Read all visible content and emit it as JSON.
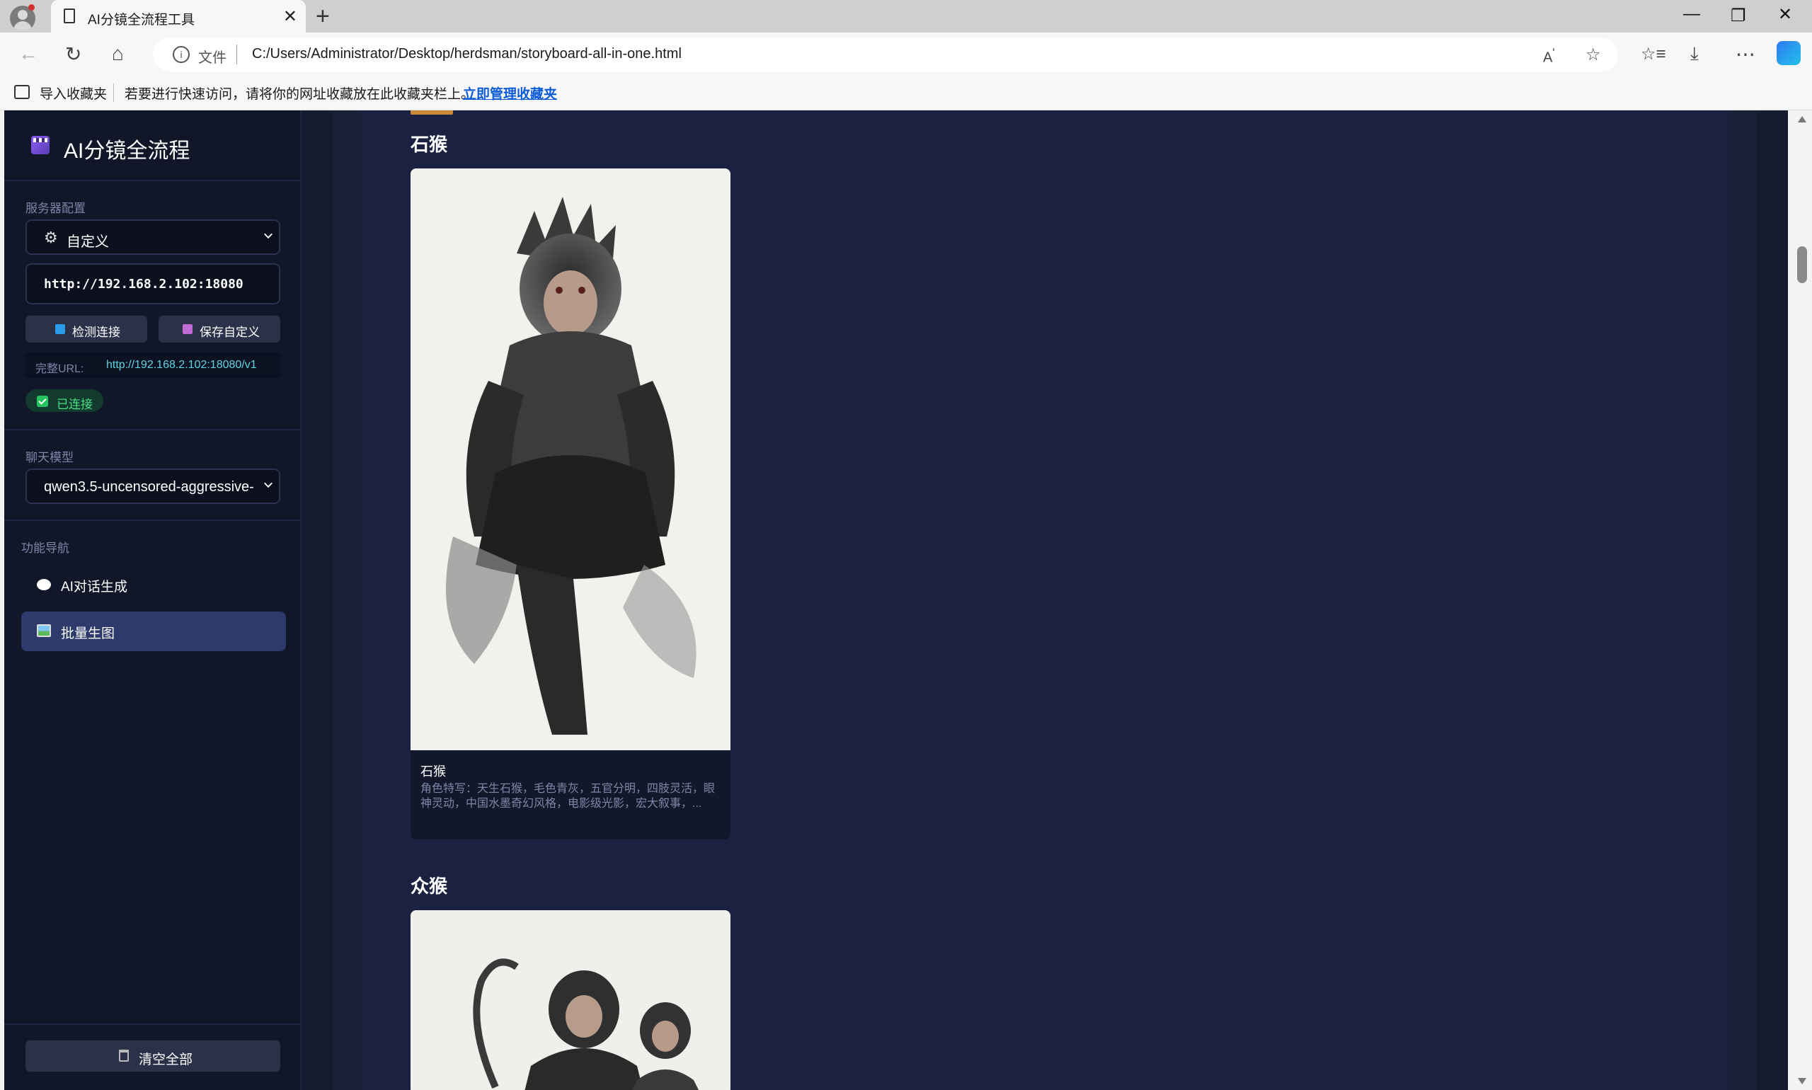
{
  "browser": {
    "tab_title": "AI分镜全流程工具",
    "address_file_label": "文件",
    "address_url": "C:/Users/Administrator/Desktop/herdsman/storyboard-all-in-one.html",
    "favorites_import": "导入收藏夹",
    "favorites_hint": "若要进行快速访问，请将你的网址收藏放在此收藏夹栏上。",
    "favorites_link": "立即管理收藏夹"
  },
  "sidebar": {
    "app_title": "AI分镜全流程",
    "server_section": "服务器配置",
    "server_select": "自定义",
    "server_input": "http://192.168.2.102:18080",
    "check_button": "检测连接",
    "save_button": "保存自定义",
    "full_url_label": "完整URL:",
    "full_url_value": "http://192.168.2.102:18080/v1",
    "status_badge": "已连接",
    "model_section": "聊天模型",
    "model_select": "qwen3.5-uncensored-aggressive-",
    "nav_section": "功能导航",
    "nav_items": [
      {
        "label": "AI对话生成",
        "active": false
      },
      {
        "label": "批量生图",
        "active": true
      }
    ],
    "clear_button": "清空全部"
  },
  "main": {
    "groups": [
      {
        "title": "石猴",
        "card_name": "石猴",
        "card_desc": "角色特写：天生石猴，毛色青灰，五官分明，四肢灵活，眼神灵动，中国水墨奇幻风格，电影级光影，宏大叙事，..."
      },
      {
        "title": "众猴"
      }
    ]
  },
  "colors": {
    "app_bg": "#161b30",
    "sidebar_bg": "#111628",
    "active_nav": "#2d3a6b",
    "connected": "#4ade80",
    "url_accent": "#5fd3e0"
  }
}
